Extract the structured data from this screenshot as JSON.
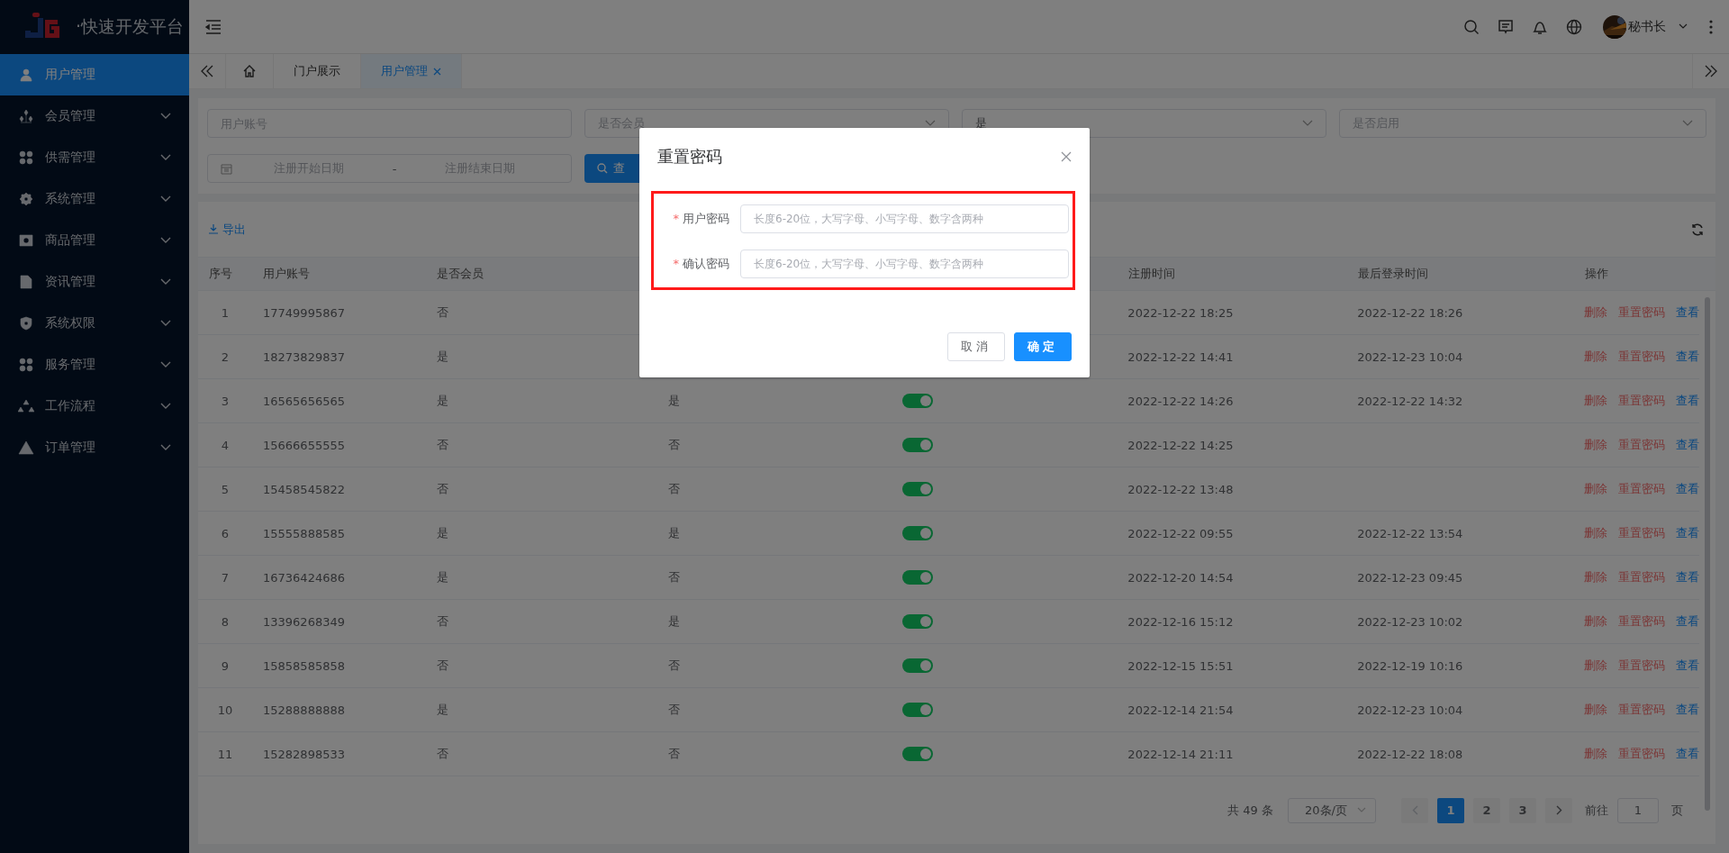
{
  "brand": {
    "title": "·快速开发平台"
  },
  "sidebar": {
    "items": [
      {
        "label": "用户管理",
        "selected": true,
        "has_submenu": false
      },
      {
        "label": "会员管理",
        "selected": false,
        "has_submenu": true
      },
      {
        "label": "供需管理",
        "selected": false,
        "has_submenu": true
      },
      {
        "label": "系统管理",
        "selected": false,
        "has_submenu": true
      },
      {
        "label": "商品管理",
        "selected": false,
        "has_submenu": true
      },
      {
        "label": "资讯管理",
        "selected": false,
        "has_submenu": true
      },
      {
        "label": "系统权限",
        "selected": false,
        "has_submenu": true
      },
      {
        "label": "服务管理",
        "selected": false,
        "has_submenu": true
      },
      {
        "label": "工作流程",
        "selected": false,
        "has_submenu": true
      },
      {
        "label": "订单管理",
        "selected": false,
        "has_submenu": true
      }
    ]
  },
  "header": {
    "user_name": "秘书长"
  },
  "tabs": [
    {
      "label": "门户展示",
      "selected": false,
      "closable": false
    },
    {
      "label": "用户管理",
      "selected": true,
      "closable": true
    }
  ],
  "filters": {
    "account": {
      "placeholder": "用户账号"
    },
    "member": {
      "placeholder": "是否会员"
    },
    "column_3": {
      "value": "是"
    },
    "enabled": {
      "placeholder": "是否启用"
    },
    "date_start": {
      "placeholder": "注册开始日期"
    },
    "date_sep": "-",
    "date_end": {
      "placeholder": "注册结束日期"
    },
    "search_button": "查"
  },
  "toolbar": {
    "export": "导出"
  },
  "table": {
    "headers": {
      "index": "序号",
      "account": "用户账号",
      "member": "是否会员",
      "registered": "注册时间",
      "last_login": "最后登录时间",
      "actions": "操作"
    },
    "rows": [
      {
        "index": "1",
        "account": "17749995867",
        "member": "否",
        "registered": "2022-12-22 18:25",
        "last_login": "2022-12-22 18:26",
        "actions": [
          {
            "label": "删除",
            "kind": "danger"
          },
          {
            "label": "重置密码",
            "kind": "danger"
          },
          {
            "label": "查看",
            "kind": "primary"
          }
        ]
      },
      {
        "index": "2",
        "account": "18273829837",
        "member": "是",
        "registered": "2022-12-22 14:41",
        "last_login": "2022-12-23 10:04",
        "actions": [
          {
            "label": "删除",
            "kind": "danger"
          },
          {
            "label": "重置密码",
            "kind": "danger"
          },
          {
            "label": "查看",
            "kind": "primary"
          }
        ]
      },
      {
        "index": "3",
        "account": "16565656565",
        "member": "是",
        "column_4": "是",
        "enabled": true,
        "registered": "2022-12-22 14:26",
        "last_login": "2022-12-22 14:32",
        "actions": [
          {
            "label": "删除",
            "kind": "danger"
          },
          {
            "label": "重置密码",
            "kind": "danger"
          },
          {
            "label": "查看",
            "kind": "primary"
          }
        ]
      },
      {
        "index": "4",
        "account": "15666655555",
        "member": "否",
        "column_4": "否",
        "enabled": true,
        "registered": "2022-12-22 14:25",
        "actions": [
          {
            "label": "删除",
            "kind": "danger"
          },
          {
            "label": "重置密码",
            "kind": "danger"
          },
          {
            "label": "查看",
            "kind": "primary"
          }
        ]
      },
      {
        "index": "5",
        "account": "15458545822",
        "member": "否",
        "column_4": "否",
        "enabled": true,
        "registered": "2022-12-22 13:48",
        "actions": [
          {
            "label": "删除",
            "kind": "danger"
          },
          {
            "label": "重置密码",
            "kind": "danger"
          },
          {
            "label": "查看",
            "kind": "primary"
          }
        ]
      },
      {
        "index": "6",
        "account": "15555888585",
        "member": "是",
        "column_4": "是",
        "enabled": true,
        "registered": "2022-12-22 09:55",
        "last_login": "2022-12-22 13:54",
        "actions": [
          {
            "label": "删除",
            "kind": "danger"
          },
          {
            "label": "重置密码",
            "kind": "danger"
          },
          {
            "label": "查看",
            "kind": "primary"
          }
        ]
      },
      {
        "index": "7",
        "account": "16736424686",
        "member": "是",
        "column_4": "否",
        "enabled": true,
        "registered": "2022-12-20 14:54",
        "last_login": "2022-12-23 09:45",
        "actions": [
          {
            "label": "删除",
            "kind": "danger"
          },
          {
            "label": "重置密码",
            "kind": "danger"
          },
          {
            "label": "查看",
            "kind": "primary"
          }
        ]
      },
      {
        "index": "8",
        "account": "13396268349",
        "member": "否",
        "column_4": "是",
        "enabled": true,
        "registered": "2022-12-16 15:12",
        "last_login": "2022-12-23 10:02",
        "actions": [
          {
            "label": "删除",
            "kind": "danger"
          },
          {
            "label": "重置密码",
            "kind": "danger"
          },
          {
            "label": "查看",
            "kind": "primary"
          }
        ]
      },
      {
        "index": "9",
        "account": "15858585858",
        "member": "否",
        "column_4": "否",
        "enabled": true,
        "registered": "2022-12-15 15:51",
        "last_login": "2022-12-19 10:16",
        "actions": [
          {
            "label": "删除",
            "kind": "danger"
          },
          {
            "label": "重置密码",
            "kind": "danger"
          },
          {
            "label": "查看",
            "kind": "primary"
          }
        ]
      },
      {
        "index": "10",
        "account": "15288888888",
        "member": "是",
        "column_4": "否",
        "enabled": true,
        "registered": "2022-12-14 21:54",
        "last_login": "2022-12-23 10:04",
        "actions": [
          {
            "label": "删除",
            "kind": "danger"
          },
          {
            "label": "重置密码",
            "kind": "danger"
          },
          {
            "label": "查看",
            "kind": "primary"
          }
        ]
      },
      {
        "index": "11",
        "account": "15282898533",
        "member": "否",
        "column_4": "否",
        "enabled": true,
        "registered": "2022-12-14 21:11",
        "last_login": "2022-12-22 18:08",
        "actions": [
          {
            "label": "删除",
            "kind": "danger"
          },
          {
            "label": "重置密码",
            "kind": "danger"
          },
          {
            "label": "查看",
            "kind": "primary"
          }
        ]
      }
    ]
  },
  "pagination": {
    "total": "共 49 条",
    "page_size": "20条/页",
    "prev_disabled": true,
    "next_disabled": false,
    "pages": [
      {
        "label": "1",
        "selected": true
      },
      {
        "label": "2",
        "selected": false
      },
      {
        "label": "3",
        "selected": false
      }
    ],
    "goto_label": "前往",
    "goto_value": "1",
    "goto_suffix": "页"
  },
  "dialog": {
    "title": "重置密码",
    "highlighted": true,
    "fields": [
      {
        "label": "用户密码",
        "required_mark": "*",
        "placeholder": "长度6-20位，大写字母、小写字母、数字含两种"
      },
      {
        "label": "确认密码",
        "required_mark": "*",
        "placeholder": "长度6-20位，大写字母、小写字母、数字含两种"
      }
    ],
    "buttons": [
      {
        "label": "取消",
        "kind": "default"
      },
      {
        "label": "确定",
        "kind": "primary"
      }
    ]
  }
}
